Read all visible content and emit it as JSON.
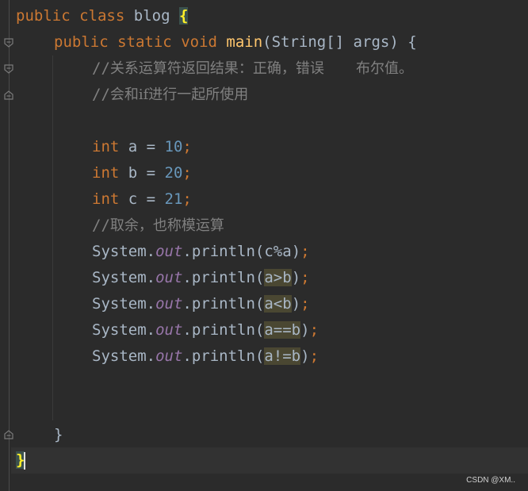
{
  "code": {
    "l1": {
      "kw1": "public",
      "kw2": "class",
      "name": "blog",
      "brace": "{"
    },
    "l2": {
      "kw1": "public",
      "kw2": "static",
      "kw3": "void",
      "fn": "main",
      "params": "(String[] args) {"
    },
    "l3": {
      "slash": "//",
      "text": "关系运算符返回结果：正确，错误       布尔值。"
    },
    "l4": {
      "slash": "//",
      "text": "会和if进行一起所使用"
    },
    "l6": {
      "kw": "int",
      "rest": " a = ",
      "num": "10",
      "semi": ";"
    },
    "l7": {
      "kw": "int",
      "rest": " b = ",
      "num": "20",
      "semi": ";"
    },
    "l8": {
      "kw": "int",
      "rest": " c = ",
      "num": "21",
      "semi": ";"
    },
    "l9": {
      "slash": "//",
      "text": "取余，也称模运算"
    },
    "l10": {
      "pre": "System.",
      "field": "out",
      "call": ".println(",
      "arg": "c%a",
      "close": ")",
      "semi": ";"
    },
    "l11": {
      "pre": "System.",
      "field": "out",
      "call": ".println(",
      "arg": "a>b",
      "close": ")",
      "semi": ";"
    },
    "l12": {
      "pre": "System.",
      "field": "out",
      "call": ".println(",
      "arg": "a<b",
      "close": ")",
      "semi": ";"
    },
    "l13": {
      "pre": "System.",
      "field": "out",
      "call": ".println(",
      "arg": "a==b",
      "close": ")",
      "semi": ";"
    },
    "l14": {
      "pre": "System.",
      "field": "out",
      "call": ".println(",
      "arg": "a!=b",
      "close": ")",
      "semi": ";"
    },
    "l17": {
      "brace": "}"
    },
    "l18": {
      "brace": "}"
    }
  },
  "watermark": "CSDN @XM..",
  "colors": {
    "background": "#2b2b2b",
    "keyword": "#cc7832",
    "number": "#6897bb",
    "comment": "#808080",
    "function": "#ffc66d",
    "field": "#9876aa",
    "brace_match": "#ffef28"
  },
  "icons": [
    "fold-icon"
  ]
}
